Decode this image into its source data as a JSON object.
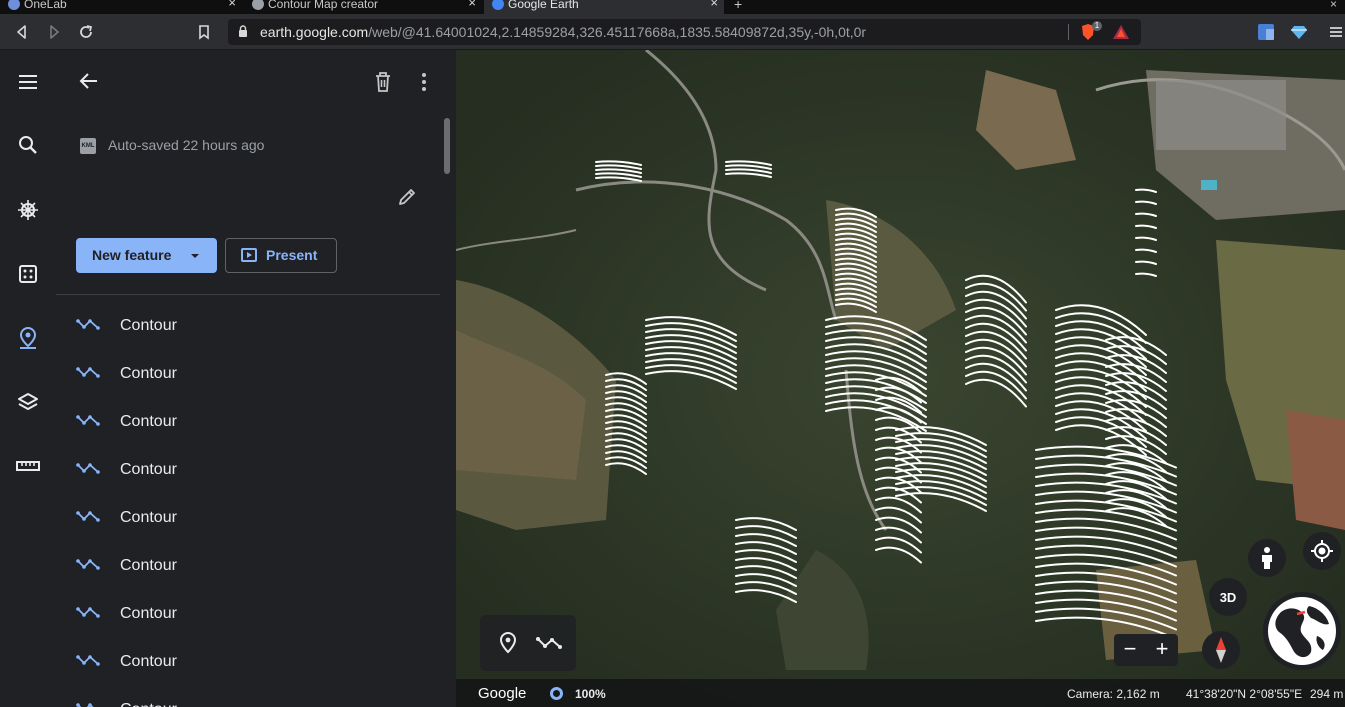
{
  "browser": {
    "tabs": [
      {
        "title": "OneLab",
        "color": "#6f8fd8"
      },
      {
        "title": "Contour Map creator",
        "color": "#9aa0a6"
      },
      {
        "title": "Google Earth",
        "color": "#4285f4"
      }
    ],
    "url_host": "earth.google.com",
    "url_path": "/web/@41.64001024,2.14859284,326.45117668a,1835.58409872d,35y,-0h,0t,0r",
    "brave_badge": "1"
  },
  "rail": {
    "items": [
      {
        "name": "menu-icon"
      },
      {
        "name": "search-icon"
      },
      {
        "name": "voyager-icon"
      },
      {
        "name": "feeling-lucky-icon"
      },
      {
        "name": "projects-icon"
      },
      {
        "name": "map-style-icon"
      },
      {
        "name": "measure-icon"
      }
    ],
    "active_color": "#8ab4f8"
  },
  "panel": {
    "autosave": "Auto-saved 22 hours ago",
    "kml_label": "KML",
    "new_feature": "New feature",
    "present": "Present",
    "features": [
      "Contour",
      "Contour",
      "Contour",
      "Contour",
      "Contour",
      "Contour",
      "Contour",
      "Contour",
      "Contour"
    ]
  },
  "map": {
    "three_d": "3D",
    "zoom_out": "−",
    "zoom_in": "+",
    "logo": "Google",
    "loading": "100%",
    "camera": "Camera: 2,162 m",
    "coordinates": "41°38'20\"N 2°08'55\"E",
    "scale": "294 m"
  }
}
